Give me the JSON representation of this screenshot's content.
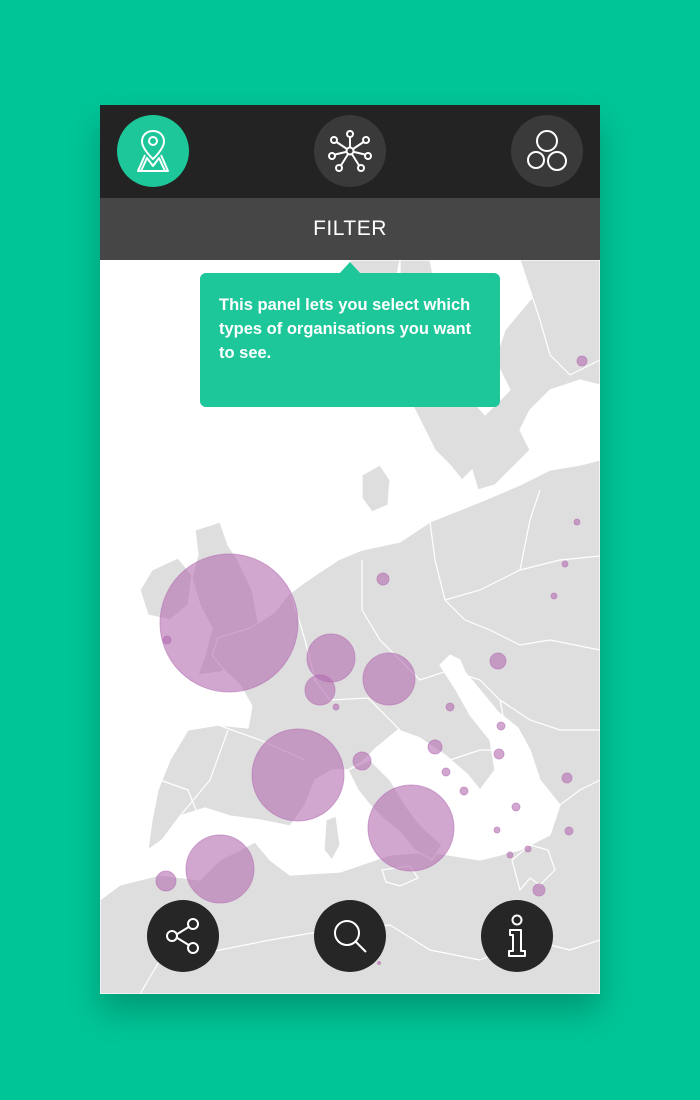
{
  "colors": {
    "background": "#00c597",
    "accent": "#1dc79a",
    "topbar": "#232323",
    "filterbar": "#464646",
    "land": "#dedede",
    "bubble": "#b26cb0"
  },
  "topnav": {
    "map_icon": "map-pin-icon",
    "network_icon": "network-icon",
    "circles_icon": "circles-icon"
  },
  "filter": {
    "label": "FILTER"
  },
  "tooltip": {
    "text": "This panel lets you select which types of organisations you want to see."
  },
  "bottomnav": {
    "share_icon": "share-icon",
    "search_icon": "search-icon",
    "info_icon": "info-icon"
  }
}
